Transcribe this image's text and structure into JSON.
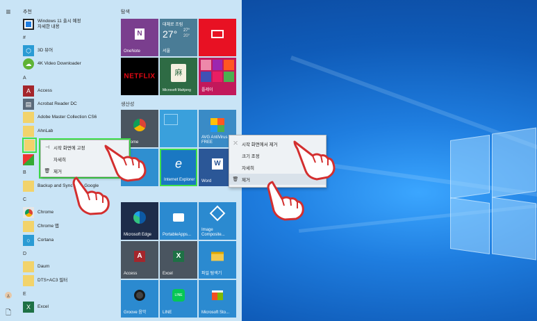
{
  "start_menu": {
    "recommended_label": "추천",
    "pinned_label": "탐색",
    "productivity_label": "생산성",
    "recommended_item": {
      "title": "Windows 11 출시 예정",
      "subtitle": "자세한 내용"
    },
    "letters": {
      "hash": "#",
      "a": "A",
      "b": "B",
      "c": "C",
      "d": "D",
      "e": "E"
    },
    "apps": [
      {
        "label": "3D 뷰어",
        "icon": "cube-icon",
        "color": "#2a9bd4"
      },
      {
        "label": "4K Video Downloader",
        "icon": "download-icon",
        "color": "#5fb336"
      },
      {
        "label": "Access",
        "icon": "access-icon",
        "color": "#a4262c"
      },
      {
        "label": "Acrobat Reader DC",
        "icon": "pdf-icon",
        "color": "#5a6a7a"
      },
      {
        "label": "Adobe Master Collection CS6",
        "icon": "folder-icon",
        "color": "#f2d36b"
      },
      {
        "label": "AhnLab",
        "icon": "folder-icon",
        "color": "#f2d36b"
      },
      {
        "label": "Backup and Sync from Google",
        "icon": "folder-icon",
        "color": "#f2d36b"
      },
      {
        "label": "Chrome",
        "icon": "chrome-icon",
        "color": "#e6e6e6"
      },
      {
        "label": "Chrome 앱",
        "icon": "folder-icon",
        "color": "#f2d36b"
      },
      {
        "label": "Cortana",
        "icon": "cortana-icon",
        "color": "#2a9bd4"
      },
      {
        "label": "Daum",
        "icon": "folder-icon",
        "color": "#f2d36b"
      },
      {
        "label": "DTS+AC3 필터",
        "icon": "folder-icon",
        "color": "#f2d36b"
      },
      {
        "label": "Excel",
        "icon": "excel-icon",
        "color": "#1e7145"
      }
    ]
  },
  "left_context_menu": {
    "items": [
      "시작 화면에 고정",
      "자세히",
      "제거"
    ]
  },
  "right_context_menu": {
    "items": [
      "시작 화면에서 제거",
      "크기 조정",
      "자세히",
      "제거"
    ]
  },
  "tiles": {
    "onenote": "OneNote",
    "weather_title": "대체로 조림",
    "weather_temp": "27°",
    "weather_high": "27°",
    "weather_low": "20°",
    "weather_city": "서울",
    "netflix": "NETFLIX",
    "mahjong": "Microsoft Mahjong",
    "play": "플레이",
    "chrome": "Chrome",
    "avg": "AVG AntiVirus FREE",
    "ie": "Internet Explorer",
    "word": "Word",
    "edge": "Microsoft Edge",
    "portableapps": "PortableApps...",
    "image_composite": "Image Composite...",
    "access": "Access",
    "excel": "Excel",
    "file_explorer": "파일 탐색기",
    "groove": "Groove 음악",
    "line": "LINE",
    "store": "Microsoft Sto..."
  },
  "colors": {
    "highlight": "#3fe04a",
    "menu_bg": "#c9e4f6",
    "accent": "#1f7ee0"
  }
}
